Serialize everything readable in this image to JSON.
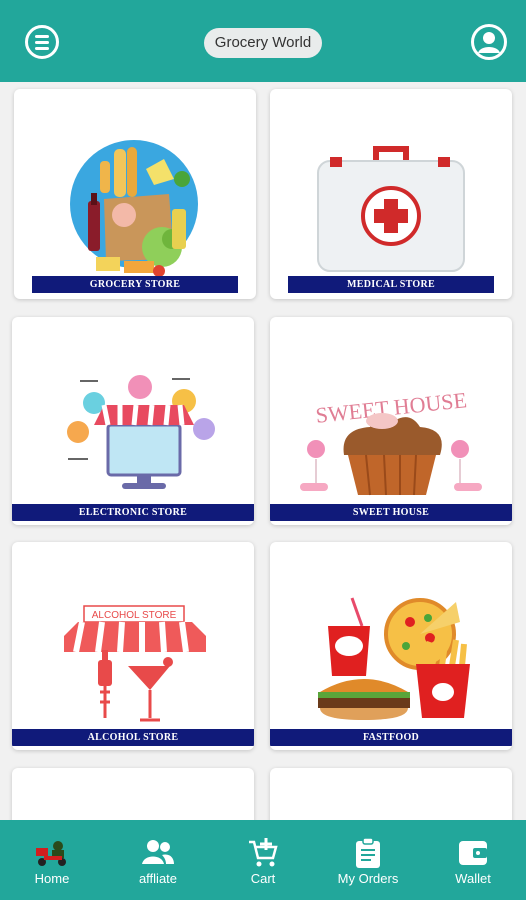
{
  "header": {
    "title": "Grocery World",
    "menu_icon": "menu-icon",
    "profile_icon": "profile-icon"
  },
  "stores": [
    {
      "label": "GROCERY STORE",
      "icon": "grocery-bag"
    },
    {
      "label": "MEDICAL STORE",
      "icon": "first-aid-kit"
    },
    {
      "label": "ELECTRONIC STORE",
      "icon": "electronics-shop"
    },
    {
      "label": "SWEET HOUSE",
      "icon": "cupcake"
    },
    {
      "label": "ALCOHOL STORE",
      "icon": "cocktail-awning"
    },
    {
      "label": "FASTFOOD",
      "icon": "burger-fries"
    }
  ],
  "scene_text": {
    "sweet_house_sign": "SWEET HOUSE",
    "alcohol_sign": "ALCOHOL STORE"
  },
  "nav": [
    {
      "label": "Home",
      "icon": "delivery-scooter-icon"
    },
    {
      "label": "affliate",
      "icon": "people-icon"
    },
    {
      "label": "Cart",
      "icon": "cart-icon"
    },
    {
      "label": "My Orders",
      "icon": "clipboard-icon"
    },
    {
      "label": "Wallet",
      "icon": "wallet-icon"
    }
  ],
  "colors": {
    "teal": "#22a79b",
    "label_bg": "#101a7a"
  }
}
